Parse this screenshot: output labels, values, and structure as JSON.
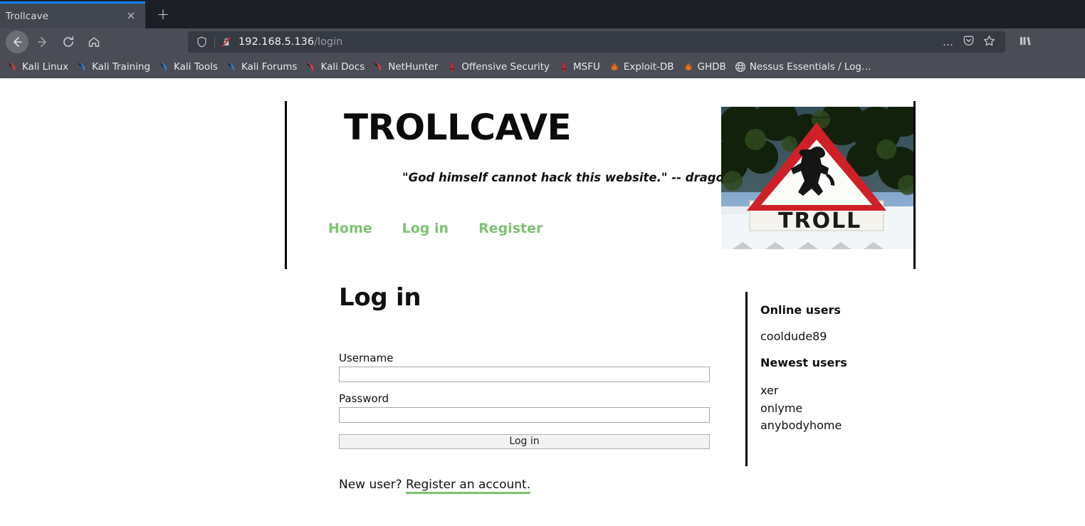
{
  "browser": {
    "tab": {
      "title": "Trollcave",
      "close_label": "×"
    },
    "newtab_label": "+",
    "nav": {
      "back": "back-arrow",
      "forward": "forward-arrow",
      "reload": "reload",
      "home": "home"
    },
    "url": {
      "host": "192.168.5.136",
      "path": "/login",
      "shield_icon": "shield-icon",
      "lock_icon": "crossed-lock-icon",
      "more_label": "…",
      "pocket_icon": "pocket-icon",
      "star_icon": "star-icon"
    },
    "library_icon": "library-icon",
    "bookmarks": [
      {
        "label": "Kali Linux",
        "icon": "kali-dragon-red"
      },
      {
        "label": "Kali Training",
        "icon": "kali-dragon-blue"
      },
      {
        "label": "Kali Tools",
        "icon": "kali-dragon-blue"
      },
      {
        "label": "Kali Forums",
        "icon": "kali-dragon-blue"
      },
      {
        "label": "Kali Docs",
        "icon": "kali-dragon-red"
      },
      {
        "label": "NetHunter",
        "icon": "kali-dragon-red"
      },
      {
        "label": "Offensive Security",
        "icon": "sword-red"
      },
      {
        "label": "MSFU",
        "icon": "sword-red"
      },
      {
        "label": "Exploit-DB",
        "icon": "bug-orange"
      },
      {
        "label": "GHDB",
        "icon": "bug-orange"
      },
      {
        "label": "Nessus Essentials / Log…",
        "icon": "globe-gray"
      }
    ]
  },
  "site": {
    "brand": "TROLLCAVE",
    "tagline": "\"God himself cannot hack this website.\" -- dragon, site admin",
    "nav": [
      {
        "label": "Home"
      },
      {
        "label": "Log in"
      },
      {
        "label": "Register"
      }
    ],
    "hero_image_alt": "troll-warning-road-sign",
    "hero_sign_text": "TROLL"
  },
  "main": {
    "title": "Log in",
    "username_label": "Username",
    "username_value": "",
    "password_label": "Password",
    "password_value": "",
    "submit_label": "Log in",
    "new_user_prefix": "New user? ",
    "register_link": "Register an account."
  },
  "sidebar": {
    "online_heading": "Online users",
    "online_users": [
      "cooldude89"
    ],
    "newest_heading": "Newest users",
    "newest_users": [
      "xer",
      "onlyme",
      "anybodyhome"
    ]
  },
  "colors": {
    "accent_green": "#7dc273",
    "chrome_bg": "#4a4d55",
    "tabbar_bg": "#1c2026",
    "active_tab_bg": "#42464f",
    "tab_accent": "#0a84ff",
    "url_bg": "#363a43"
  }
}
